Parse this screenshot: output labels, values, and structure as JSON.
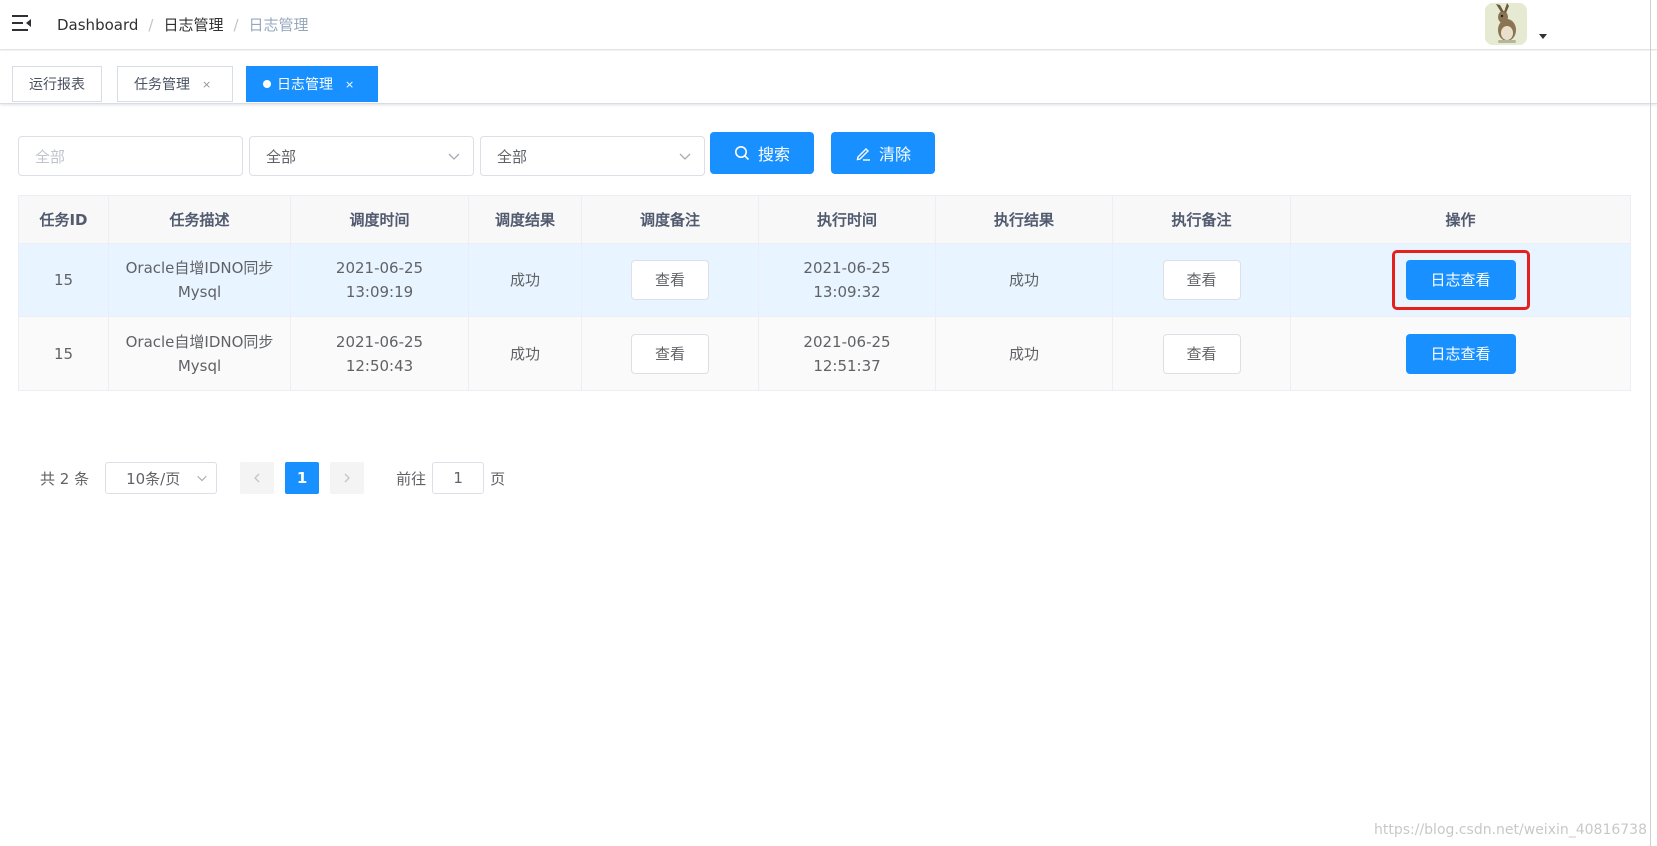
{
  "navbar": {
    "breadcrumb": [
      "Dashboard",
      "日志管理",
      "日志管理"
    ],
    "separator": "/"
  },
  "tags": [
    {
      "label": "运行报表",
      "closable": false,
      "active": false
    },
    {
      "label": "任务管理",
      "closable": true,
      "active": false
    },
    {
      "label": "日志管理",
      "closable": true,
      "active": true
    }
  ],
  "tag_close_glyph": "×",
  "filter": {
    "task_input_placeholder": "全部",
    "select1_value": "全部",
    "select2_value": "全部",
    "search_label": "搜索",
    "clear_label": "清除"
  },
  "table": {
    "headers": [
      "任务ID",
      "任务描述",
      "调度时间",
      "调度结果",
      "调度备注",
      "执行时间",
      "执行结果",
      "执行备注",
      "操作"
    ],
    "rows": [
      {
        "id": "15",
        "desc_line1": "Oracle自增IDNO同步",
        "desc_line2": "Mysql",
        "schedule_time": "2021-06-25 13:09:19",
        "schedule_result": "成功",
        "schedule_note_btn": "查看",
        "exec_time": "2021-06-25 13:09:32",
        "exec_result": "成功",
        "exec_note_btn": "查看",
        "action_btn": "日志查看"
      },
      {
        "id": "15",
        "desc_line1": "Oracle自增IDNO同步",
        "desc_line2": "Mysql",
        "schedule_time": "2021-06-25 12:50:43",
        "schedule_result": "成功",
        "schedule_note_btn": "查看",
        "exec_time": "2021-06-25 12:51:37",
        "exec_result": "成功",
        "exec_note_btn": "查看",
        "action_btn": "日志查看"
      }
    ]
  },
  "pagination": {
    "total": "共 2 条",
    "page_size": "10条/页",
    "current_page": "1",
    "goto_label": "前往",
    "goto_value": "1",
    "page_unit": "页"
  },
  "watermark": "https://blog.csdn.net/weixin_40816738",
  "colors": {
    "primary": "#1890ff",
    "highlight_border": "#e6211b"
  }
}
